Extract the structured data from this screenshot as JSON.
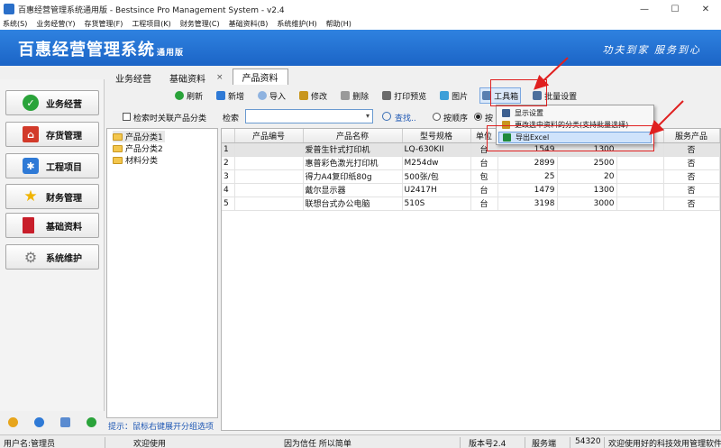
{
  "window": {
    "title": "百惠经营管理系统通用版 - Bestsince Pro Management System - v2.4",
    "minimize": "—",
    "maximize": "☐",
    "close": "✕"
  },
  "menu": [
    "系统(S)",
    "业务经营(Y)",
    "存货管理(F)",
    "工程项目(K)",
    "财务管理(C)",
    "基础资料(B)",
    "系统维护(H)",
    "帮助(H)"
  ],
  "banner": {
    "title": "百惠经营管理系统",
    "edition": "通用版",
    "slogan": "功夫到家 服务到心"
  },
  "nav": [
    {
      "label": "业务经营",
      "icon": "check-circle-icon",
      "color": "#2aa33a"
    },
    {
      "label": "存货管理",
      "icon": "house-icon",
      "color": "#d23a2a"
    },
    {
      "label": "工程项目",
      "icon": "gear-puzzle-icon",
      "color": "#2f7ad6"
    },
    {
      "label": "财务管理",
      "icon": "star-icon",
      "color": "#f0b400"
    },
    {
      "label": "基础资料",
      "icon": "book-icon",
      "color": "#c81e2a"
    },
    {
      "label": "系统维护",
      "icon": "gear-icon",
      "color": "#7a7a7a"
    }
  ],
  "tabs": [
    {
      "label": "业务经营"
    },
    {
      "label": "基础资料",
      "close": "×"
    },
    {
      "label": "产品资料"
    }
  ],
  "toolbar": {
    "refresh": "刷新",
    "add": "新增",
    "import": "导入",
    "edit": "修改",
    "delete": "删除",
    "print": "打印预览",
    "picture": "图片",
    "toolbox": "工具箱",
    "batch": "批量设置"
  },
  "filters": {
    "search_related": "检索时关联产品分类",
    "search_label": "检索",
    "search_value": "",
    "find": "查找..",
    "order_seq": "按顺序",
    "order_other": "按"
  },
  "tree": [
    "产品分类1",
    "产品分类2",
    "材料分类"
  ],
  "hint": "提示：鼠标右键展开分组选项",
  "grid": {
    "columns": [
      "产品编号",
      "产品名称",
      "型号规格",
      "单位",
      "",
      "",
      "",
      "服务产品"
    ],
    "rows": [
      {
        "no": "1",
        "code": "",
        "name": "爱普生针式打印机",
        "model": "LQ-630KII",
        "unit": "台",
        "c1": "1549",
        "c2": "1300",
        "c3": "",
        "service": "否"
      },
      {
        "no": "2",
        "code": "",
        "name": "惠普彩色激光打印机",
        "model": "M254dw",
        "unit": "台",
        "c1": "2899",
        "c2": "2500",
        "c3": "",
        "service": "否"
      },
      {
        "no": "3",
        "code": "",
        "name": "得力A4复印纸80g",
        "model": "500张/包",
        "unit": "包",
        "c1": "25",
        "c2": "20",
        "c3": "",
        "service": "否"
      },
      {
        "no": "4",
        "code": "",
        "name": "戴尔显示器",
        "model": "U2417H",
        "unit": "台",
        "c1": "1479",
        "c2": "1300",
        "c3": "",
        "service": "否"
      },
      {
        "no": "5",
        "code": "",
        "name": "联想台式办公电脑",
        "model": "510S",
        "unit": "台",
        "c1": "3198",
        "c2": "3000",
        "c3": "",
        "service": "否"
      }
    ]
  },
  "dropdown": {
    "items": [
      "显示设置",
      "更改选中资料的分类(支持批量选择)",
      "导出Excel"
    ]
  },
  "status": {
    "user": "用户名:管理员",
    "welcome": "欢迎使用",
    "motto": "因为信任 所以简单",
    "version": "版本号2.4",
    "server_label": "服务端",
    "server_port": "54320",
    "thanks": "欢迎使用好的科技效用管理软件"
  }
}
